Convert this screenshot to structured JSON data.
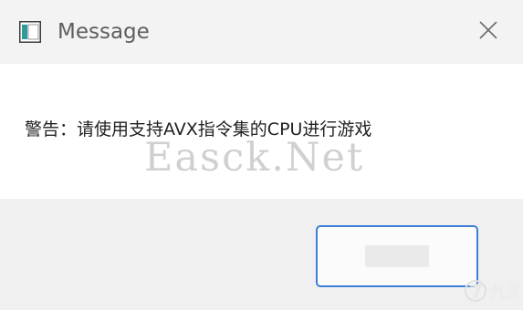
{
  "window": {
    "title": "Message",
    "app_icon": "window-app-icon",
    "close_icon": "close-icon"
  },
  "dialog": {
    "message": "警告：请使用支持AVX指令集的CPU进行游戏",
    "ok_label": ""
  },
  "overlays": {
    "watermark_text": "Easck.Net",
    "brand_logo_text": "九游",
    "brand_logo_icon": "jiuyou-logo-icon"
  },
  "colors": {
    "titlebar_bg": "#f3f3f3",
    "content_bg": "#ffffff",
    "footer_bg": "#f0f0f0",
    "button_border": "#3c7fd8"
  }
}
